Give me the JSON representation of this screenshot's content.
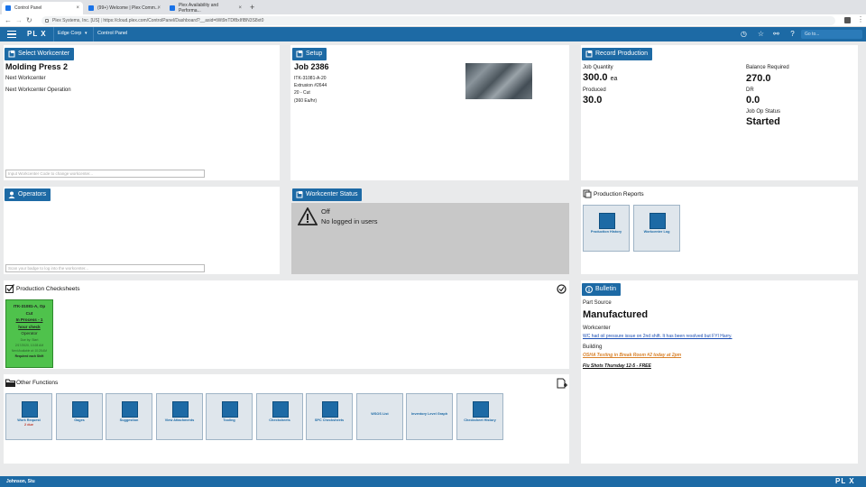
{
  "browser": {
    "tabs": [
      {
        "label": "Control Panel",
        "active": true
      },
      {
        "label": "(99+) Welcome | Plex Comm...",
        "active": false
      },
      {
        "label": "Plex Availability and Performa...",
        "active": false
      }
    ],
    "new_tab": "+",
    "url": "https://cloud.plex.com/ControlPanel/Dashboard?__asid=tWt9nTDf8xIfIBN3S8xt0",
    "site_info": "Plex Systems, Inc. [US]"
  },
  "appnav": {
    "logo": "PL X",
    "company": "Edge Corp",
    "breadcrumb": "Control Panel",
    "goto_placeholder": "Go to..."
  },
  "workcenter": {
    "button": "Select Workcenter",
    "name": "Molding Press 2",
    "next_workcenter": "Next Workcenter",
    "next_operation": "Next Workcenter Operation",
    "input_placeholder": "Input Workcenter Code to change workcenter..."
  },
  "setup": {
    "button": "Setup",
    "job": "Job 2386",
    "lines": [
      "ITK-31081-A-20",
      "Extrusion #2644",
      "20 - Cut",
      "(360 Ea/hr)"
    ]
  },
  "record_production": {
    "button": "Record Production",
    "job_quantity_label": "Job Quantity",
    "job_quantity": "300.0",
    "job_quantity_unit": "ea",
    "produced_label": "Produced",
    "produced": "30.0",
    "balance_label": "Balance Required",
    "balance": "270.0",
    "dr_label": "DR",
    "dr": "0.0",
    "status_label": "Job Op Status",
    "status": "Started"
  },
  "operators": {
    "button": "Operators",
    "input_placeholder": "Scan your badge to log into the workcenter..."
  },
  "workcenter_status": {
    "button": "Workcenter Status",
    "state": "Off",
    "users": "No logged in users"
  },
  "production_reports": {
    "title": "Production Reports",
    "tiles": [
      {
        "label": "Production History"
      },
      {
        "label": "Workcenter Log"
      }
    ]
  },
  "checksheets": {
    "title": "Production Checksheets",
    "card": {
      "line1": "ITK-31081-A, Op",
      "line2": "Cut",
      "status1": "In Process - 1",
      "status2": "hour check",
      "role": "Operator",
      "due": "Due by: Start",
      "date": "2/17/2020, 10:28 AM",
      "next": "Next Available at: 10:28 AM",
      "freq": "Required each Shift",
      "color": "#4fc24c"
    }
  },
  "bulletin": {
    "button": "Bulletin",
    "part_source_label": "Part Source",
    "part_source": "Manufactured",
    "workcenter_label": "Workcenter",
    "workcenter_msg": "WC had oil pressure issue on 2nd shift. It has been resolved but FYI Harry.",
    "building_label": "Building",
    "building_msg1": "OSHA Testing in Break Room #2 today at 2pm",
    "building_msg2": "Flu Shots Thursday 12-5 - FREE"
  },
  "other_functions": {
    "title": "Other Functions",
    "tiles": [
      {
        "label": "Work Request",
        "sub": "2 due"
      },
      {
        "label": "Gages",
        "sub": ""
      },
      {
        "label": "Suggestion",
        "sub": ""
      },
      {
        "label": "View Attachments",
        "sub": ""
      },
      {
        "label": "Tooling",
        "sub": ""
      },
      {
        "label": "Checksheets",
        "sub": ""
      },
      {
        "label": "SPC Checksheets",
        "sub": ""
      },
      {
        "label": "WSOS List",
        "sub": ""
      },
      {
        "label": "Inventory Level Graph",
        "sub": ""
      },
      {
        "label": "Checksheet History",
        "sub": ""
      }
    ]
  },
  "footer": {
    "user": "Johnson, Stu",
    "logo": "PL X"
  },
  "colors": {
    "brand": "#1d6aa5",
    "status_bg": "#c8c8c8",
    "checksheet_green": "#4fc24c"
  }
}
